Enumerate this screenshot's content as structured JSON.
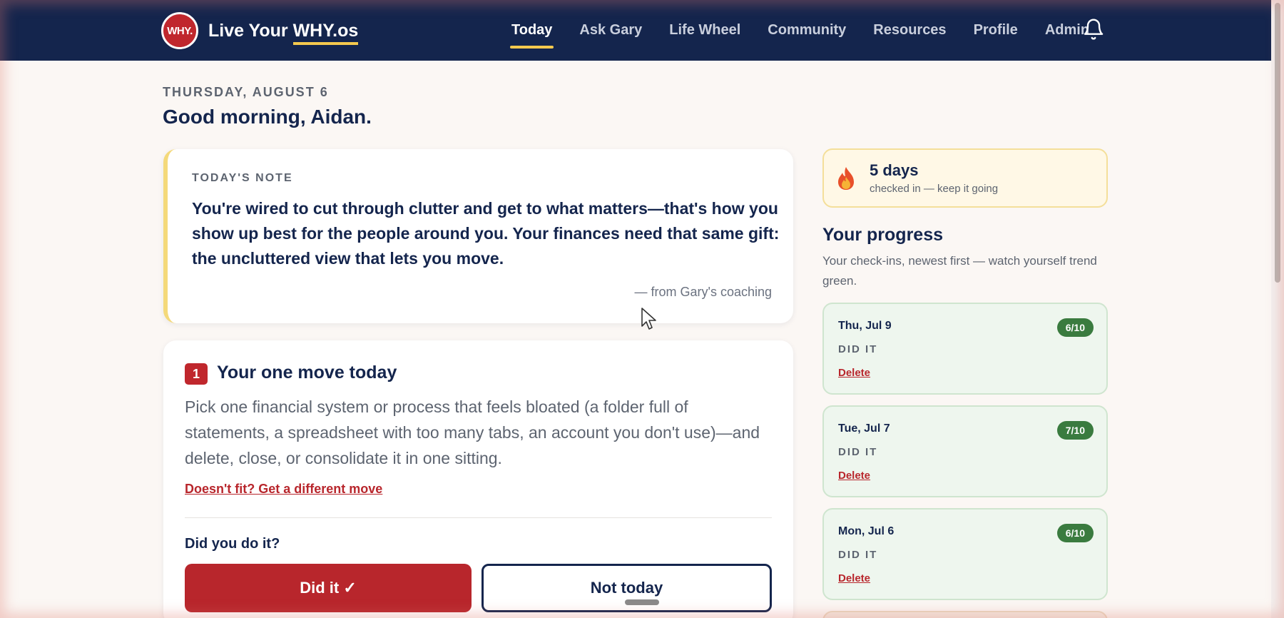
{
  "header": {
    "logo_text": "WHY.",
    "brand_prefix": "Live Your ",
    "brand_em": "WHY.os",
    "nav": [
      {
        "label": "Today",
        "active": true
      },
      {
        "label": "Ask Gary",
        "active": false
      },
      {
        "label": "Life Wheel",
        "active": false
      },
      {
        "label": "Community",
        "active": false
      },
      {
        "label": "Resources",
        "active": false
      },
      {
        "label": "Profile",
        "active": false
      },
      {
        "label": "Admin",
        "active": false
      }
    ],
    "bell_icon": "bell-icon"
  },
  "page": {
    "date": "THURSDAY, AUGUST 6",
    "greeting": "Good morning, Aidan."
  },
  "note": {
    "label": "TODAY'S NOTE",
    "text": "You're wired to cut through clutter and get to what matters—that's how you show up best for the people around you. Your finances need that same gift: the uncluttered view that lets you move.",
    "source": "— from Gary's coaching"
  },
  "move": {
    "number": "1",
    "title": "Your one move today",
    "description": "Pick one financial system or process that feels bloated (a folder full of statements, a spreadsheet with too many tabs, an account you don't use)—and delete, close, or consolidate it in one sitting.",
    "alt_link": "Doesn't fit? Get a different move",
    "question": "Did you do it?",
    "did_label": "Did it ✓",
    "not_label": "Not today"
  },
  "streak": {
    "icon": "fire-icon",
    "days": "5 days",
    "sub": "checked in — keep it going"
  },
  "progress": {
    "title": "Your progress",
    "subtitle": "Your check-ins, newest first — watch yourself trend green.",
    "checkins": [
      {
        "date": "Thu, Jul 9",
        "score": "6/10",
        "status": "DID IT",
        "delete": "Delete"
      },
      {
        "date": "Tue, Jul 7",
        "score": "7/10",
        "status": "DID IT",
        "delete": "Delete"
      },
      {
        "date": "Mon, Jul 6",
        "score": "6/10",
        "status": "DID IT",
        "delete": "Delete"
      }
    ]
  },
  "colors": {
    "navy": "#14254d",
    "brand_red": "#c0272d",
    "accent_yellow": "#f4c94e",
    "success_green": "#3a7b3f"
  }
}
